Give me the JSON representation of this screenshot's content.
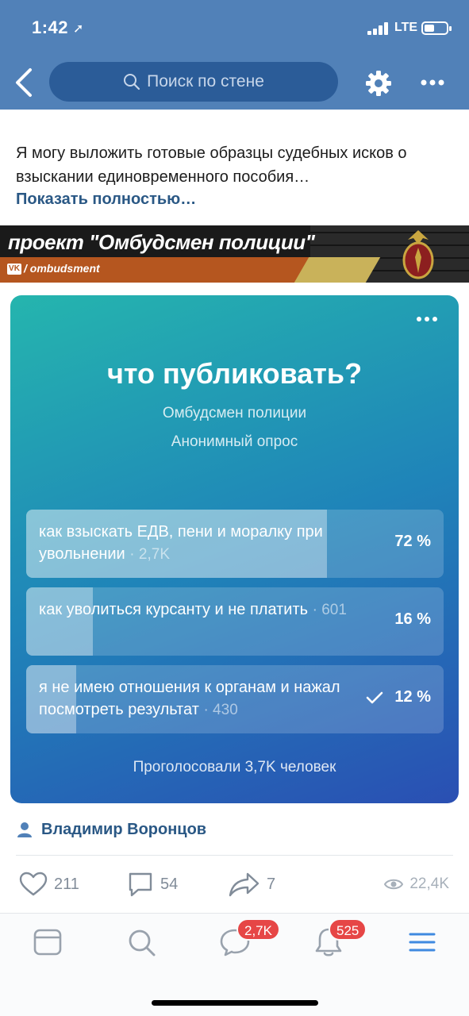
{
  "status_bar": {
    "time": "1:42",
    "network": "LTE"
  },
  "header": {
    "search_placeholder": "Поиск по стене"
  },
  "post": {
    "text": "Я могу выложить готовые образцы судебных исков о взыскании единовременного пособия…",
    "show_more": "Показать полностью…",
    "banner": {
      "title": "проект \"Омбудсмен полиции\"",
      "handle": "/ ombudsment"
    }
  },
  "poll": {
    "question": "что публиковать?",
    "author": "Омбудсмен полиции",
    "type": "Анонимный опрос",
    "options": [
      {
        "label": "как взыскать ЕДВ, пени и моралку при увольнении",
        "count": "· 2,7K",
        "percent": "72 %",
        "fraction": 0.72,
        "voted": false
      },
      {
        "label": "как уволиться курсанту и не платить",
        "count": "· 601",
        "percent": "16 %",
        "fraction": 0.16,
        "voted": false
      },
      {
        "label": "я не имею отношения к органам и нажал посмотреть результат",
        "count": "· 430",
        "percent": "12 %",
        "fraction": 0.12,
        "voted": true
      }
    ],
    "total": "Проголосовали 3,7K человек"
  },
  "signer": {
    "name": "Владимир Воронцов"
  },
  "actions": {
    "likes": "211",
    "comments": "54",
    "shares": "7",
    "views": "22,4K"
  },
  "tabbar": {
    "messages_badge": "2,7K",
    "notifications_badge": "525"
  },
  "colors": {
    "header": "#5181b8",
    "link": "#2a5885",
    "badge": "#e64646",
    "poll_gradient_start": "#25b5ae",
    "poll_gradient_end": "#2a4fb3"
  }
}
